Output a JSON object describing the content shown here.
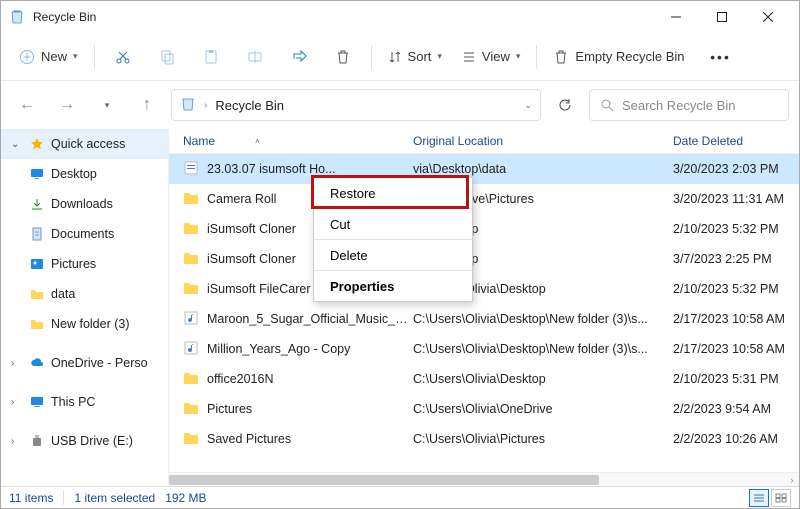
{
  "window": {
    "title": "Recycle Bin"
  },
  "toolbar": {
    "new_label": "New",
    "sort_label": "Sort",
    "view_label": "View",
    "empty_label": "Empty Recycle Bin"
  },
  "address": {
    "crumb": "Recycle Bin"
  },
  "search": {
    "placeholder": "Search Recycle Bin"
  },
  "sidebar": {
    "items": [
      {
        "label": "Quick access"
      },
      {
        "label": "Desktop"
      },
      {
        "label": "Downloads"
      },
      {
        "label": "Documents"
      },
      {
        "label": "Pictures"
      },
      {
        "label": "data"
      },
      {
        "label": "New folder (3)"
      },
      {
        "label": "OneDrive - Perso"
      },
      {
        "label": "This PC"
      },
      {
        "label": "USB Drive (E:)"
      }
    ]
  },
  "columns": {
    "name": "Name",
    "loc": "Original Location",
    "date": "Date Deleted"
  },
  "rows": [
    {
      "name": "23.03.07 isumsoft Ho...",
      "loc": "via\\Desktop\\data",
      "date": "3/20/2023 2:03 PM",
      "type": "doc"
    },
    {
      "name": "Camera Roll",
      "loc": "via\\OneDrive\\Pictures",
      "date": "3/20/2023 11:31 AM",
      "type": "folder"
    },
    {
      "name": "iSumsoft Cloner",
      "loc": "via\\Desktop",
      "date": "2/10/2023 5:32 PM",
      "type": "folder"
    },
    {
      "name": "iSumsoft Cloner",
      "loc": "via\\Desktop",
      "date": "3/7/2023 2:25 PM",
      "type": "folder"
    },
    {
      "name": "iSumsoft FileCarer",
      "loc": "C:\\Users\\Olivia\\Desktop",
      "date": "2/10/2023 5:32 PM",
      "type": "folder"
    },
    {
      "name": "Maroon_5_Sugar_Official_Music_Vi...",
      "loc": "C:\\Users\\Olivia\\Desktop\\New folder (3)\\s...",
      "date": "2/17/2023 10:58 AM",
      "type": "music"
    },
    {
      "name": "Million_Years_Ago - Copy",
      "loc": "C:\\Users\\Olivia\\Desktop\\New folder (3)\\s...",
      "date": "2/17/2023 10:58 AM",
      "type": "music"
    },
    {
      "name": "office2016N",
      "loc": "C:\\Users\\Olivia\\Desktop",
      "date": "2/10/2023 5:31 PM",
      "type": "folder"
    },
    {
      "name": "Pictures",
      "loc": "C:\\Users\\Olivia\\OneDrive",
      "date": "2/2/2023 9:54 AM",
      "type": "folder"
    },
    {
      "name": "Saved Pictures",
      "loc": "C:\\Users\\Olivia\\Pictures",
      "date": "2/2/2023 10:26 AM",
      "type": "folder"
    }
  ],
  "context_menu": {
    "restore": "Restore",
    "cut": "Cut",
    "delete": "Delete",
    "properties": "Properties"
  },
  "status": {
    "count": "11 items",
    "selected": "1 item selected",
    "size": "192 MB"
  }
}
